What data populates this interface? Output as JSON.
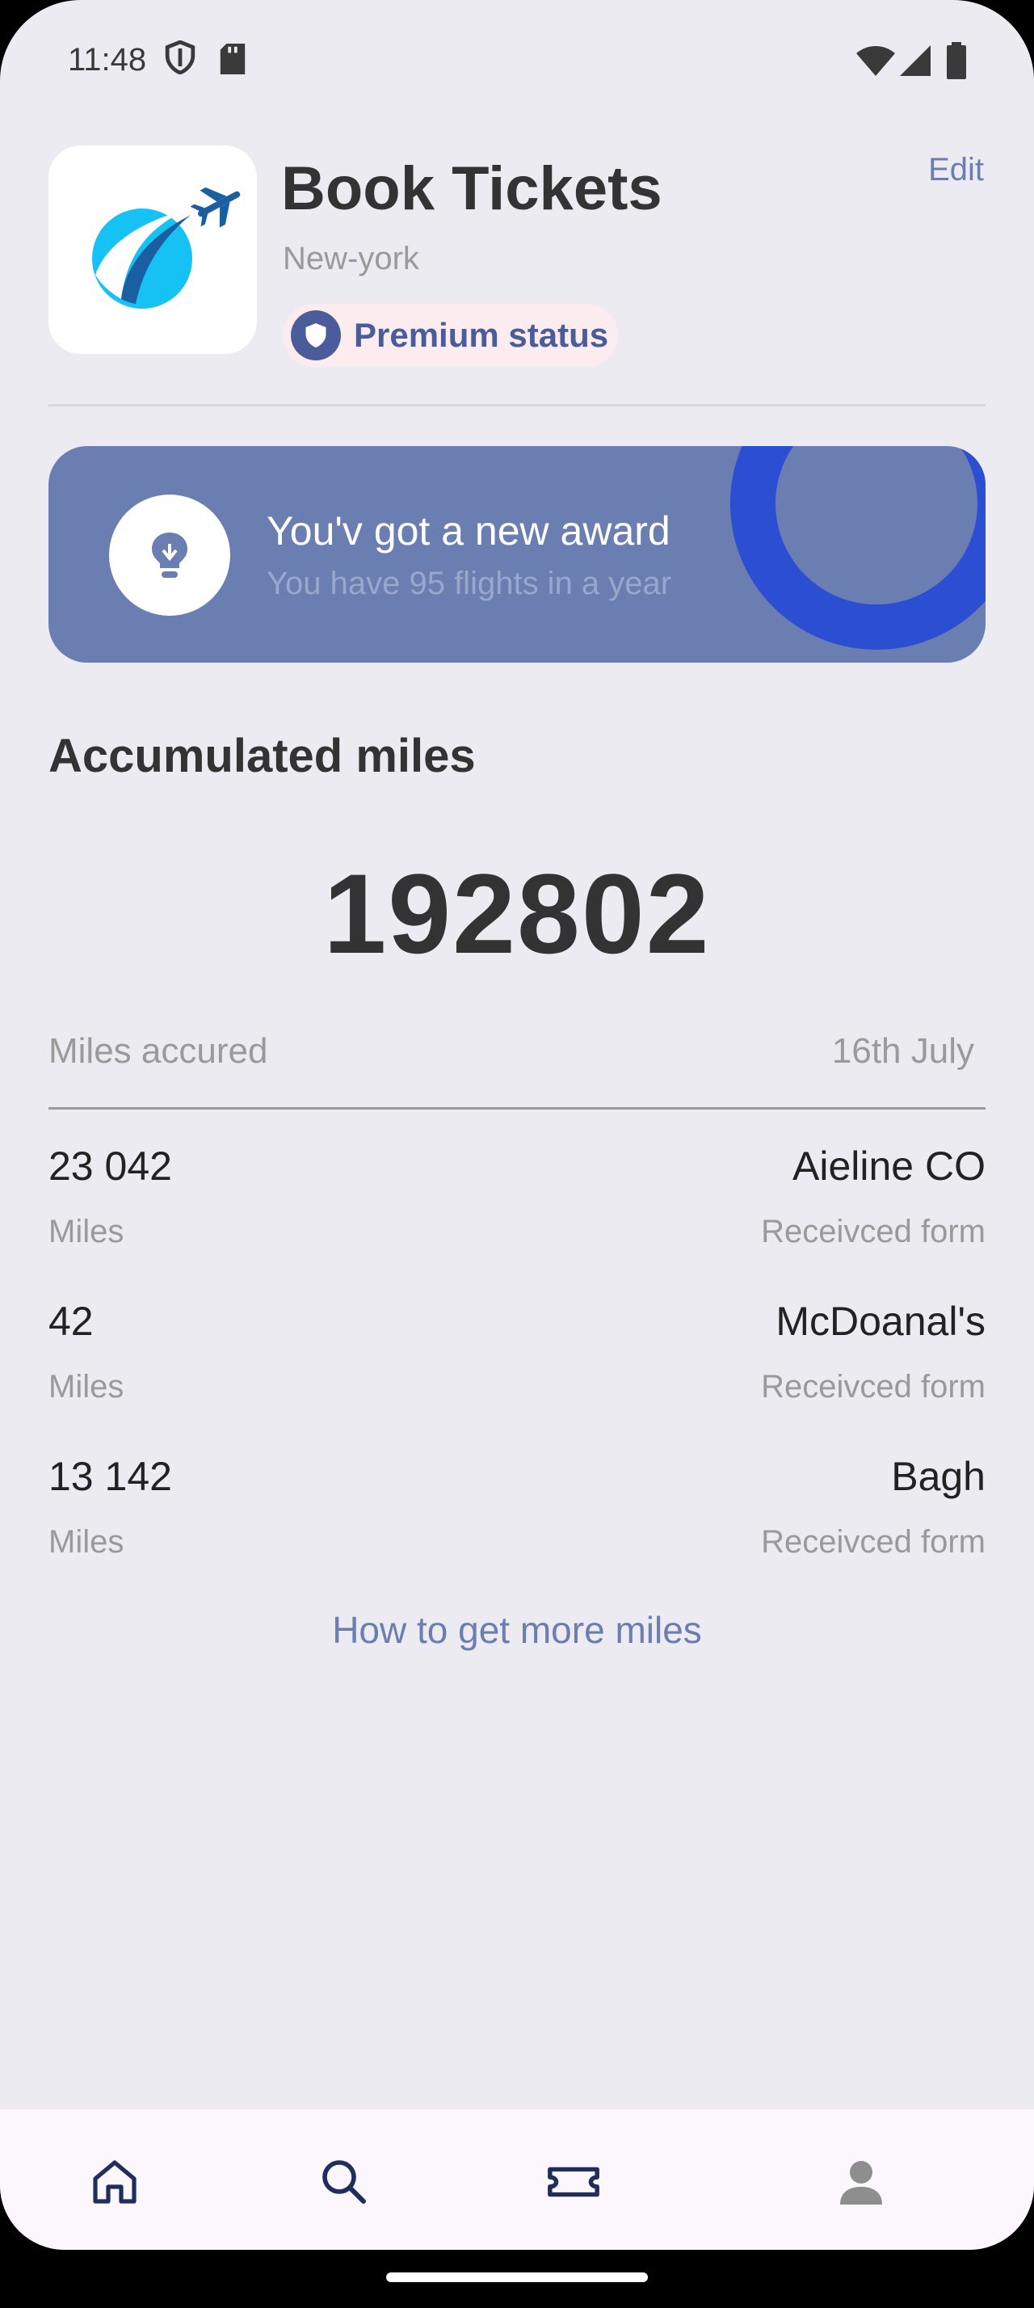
{
  "status_bar": {
    "time": "11:48"
  },
  "header": {
    "title": "Book Tickets",
    "location": "New-york",
    "edit_label": "Edit",
    "badge_label": "Premium status"
  },
  "award": {
    "title": "You'v got a new award",
    "subtitle": "You have  95 flights in a year"
  },
  "miles": {
    "section_title": "Accumulated miles",
    "total": "192802",
    "accrued_label": "Miles accured",
    "date": "16th July",
    "rows": [
      {
        "amount": "23 042",
        "unit": "Miles",
        "source": "Aieline CO",
        "source_label": "Receivced form"
      },
      {
        "amount": "42",
        "unit": "Miles",
        "source": "McDoanal's",
        "source_label": "Receivced form"
      },
      {
        "amount": "13 142",
        "unit": "Miles",
        "source": "Bagh",
        "source_label": "Receivced form"
      }
    ],
    "more_link": "How to get more miles"
  },
  "colors": {
    "accent": "#6A7EB2",
    "badge_bg": "#FBEDEF",
    "link": "#6C7EB0",
    "ring": "#2B4ED3"
  },
  "icons": [
    "shield-icon",
    "sd-card-icon",
    "wifi-icon",
    "signal-icon",
    "battery-icon",
    "lightbulb-icon",
    "home-icon",
    "search-icon",
    "ticket-icon",
    "profile-icon"
  ]
}
